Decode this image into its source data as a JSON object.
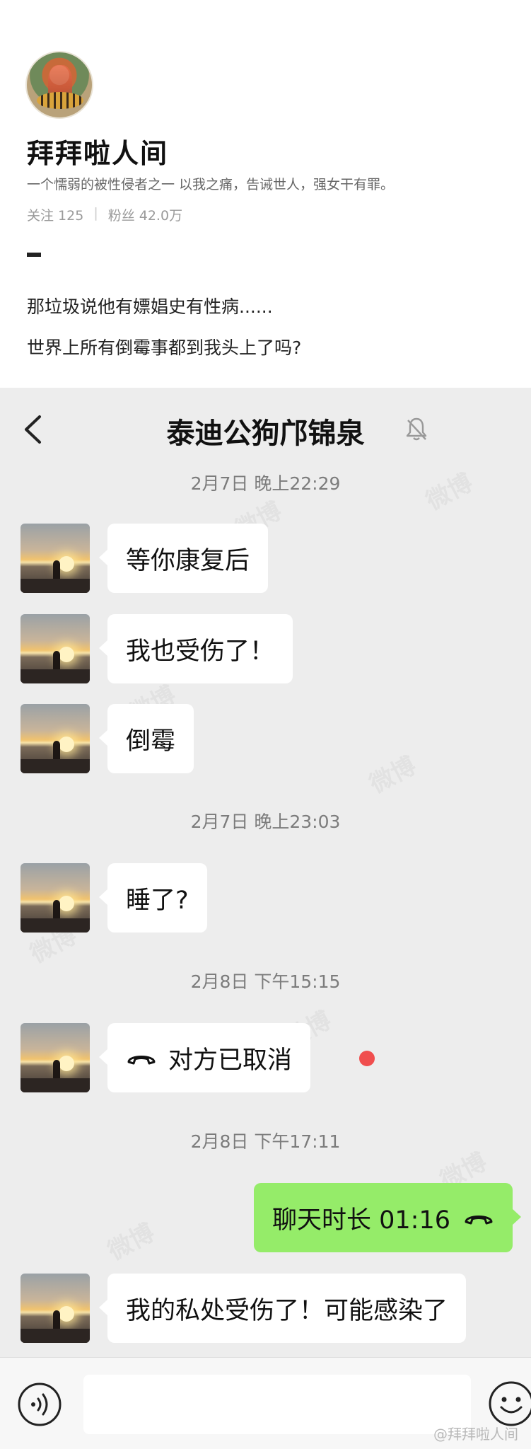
{
  "profile": {
    "name": "拜拜啦人间",
    "bio": "一个懦弱的被性侵者之一  以我之痛，告诫世人，强女干有罪。",
    "following_label": "关注 125",
    "followers_label": "粉丝 42.0万",
    "stats_separator": "|",
    "post_lines": [
      "那垃圾说他有嫖娼史有性病......",
      "世界上所有倒霉事都到我头上了吗?"
    ]
  },
  "chat": {
    "title": "泰迪公狗邝锦泉",
    "icons": {
      "back": "back-chevron-icon",
      "mute": "muted-bell-icon",
      "call": "phone-hangup-icon",
      "voice": "voice-input-icon",
      "emoji": "emoji-icon"
    },
    "timestamps": [
      "2月7日 晚上22:29",
      "2月7日 晚上23:03",
      "2月8日 下午15:15",
      "2月8日 下午17:11"
    ],
    "messages": [
      {
        "sender": "other",
        "text": "等你康复后"
      },
      {
        "sender": "other",
        "text": "我也受伤了！"
      },
      {
        "sender": "other",
        "text": "倒霉"
      },
      {
        "sender": "other",
        "text": "睡了?"
      },
      {
        "sender": "other",
        "text": "对方已取消"
      },
      {
        "sender": "self",
        "text": "聊天时长 01:16"
      },
      {
        "sender": "other",
        "text": "我的私处受伤了！可能感染了"
      }
    ],
    "colors": {
      "background": "#ededed",
      "self_bubble": "#95ec69",
      "other_bubble": "#ffffff",
      "unread_dot": "#f04e4e"
    }
  },
  "footer": {
    "credit": "@拜拜啦人间"
  }
}
